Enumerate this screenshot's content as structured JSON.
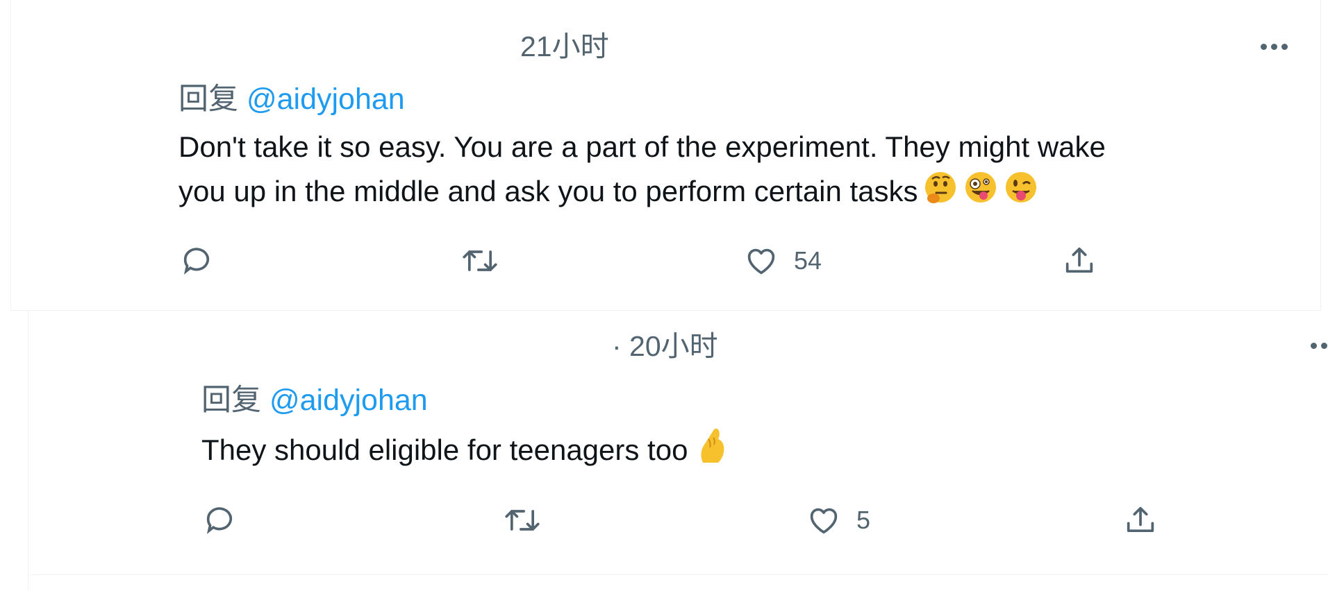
{
  "tweets": [
    {
      "time": "21小时",
      "reply_prefix": "回复",
      "reply_handle": "@aidyjohan",
      "text_line1": "Don't take it so easy. You are a part of the experiment. They might wake",
      "text_line2": "you up in the middle and ask you to perform certain tasks",
      "emojis": [
        "thinking-face",
        "zany-face",
        "winking-face-with-tongue"
      ],
      "like_count": "54"
    },
    {
      "time": "· 20小时",
      "reply_prefix": "回复",
      "reply_handle": "@aidyjohan",
      "text_line1": "They should eligible for teenagers too",
      "emojis": [
        "pinched-fingers"
      ],
      "like_count": "5"
    }
  ],
  "icons": {
    "reply": "reply-bubble-icon",
    "retweet": "retweet-arrows-icon",
    "like": "heart-icon",
    "share": "share-upload-icon",
    "more": "more-dots-icon"
  },
  "colors": {
    "secondary": "#536471",
    "link": "#1d9bf0",
    "text": "#0f1419",
    "border": "#eff3f4"
  }
}
